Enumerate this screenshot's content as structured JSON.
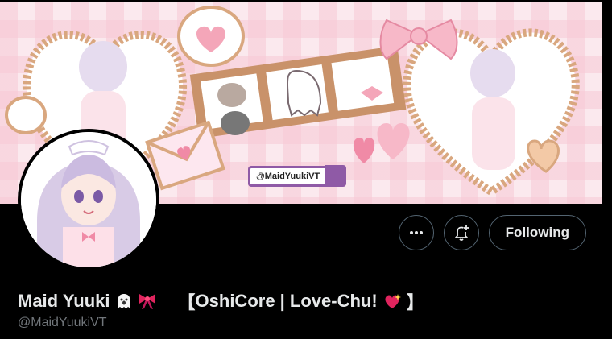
{
  "banner": {
    "chip_handle": "@MaidYuukiVT"
  },
  "actions": {
    "more_icon": "more-icon",
    "subscribe_icon": "bell-plus-icon",
    "following_label": "Following"
  },
  "profile": {
    "display_name": "Maid Yuuki",
    "name_emojis": [
      "ghost",
      "ribbon"
    ],
    "bio_tag_open": "【",
    "bio_tag_text": "OshiCore | Love-Chu!",
    "bio_tag_emoji": "sparkling-heart",
    "bio_tag_close": "】",
    "handle": "@MaidYuukiVT"
  },
  "colors": {
    "background": "#000000",
    "text_primary": "#e7e9ea",
    "text_secondary": "#71767b",
    "border": "#536471",
    "banner_pink": "#fbe9ee",
    "banner_accent": "#8f5aa6"
  }
}
